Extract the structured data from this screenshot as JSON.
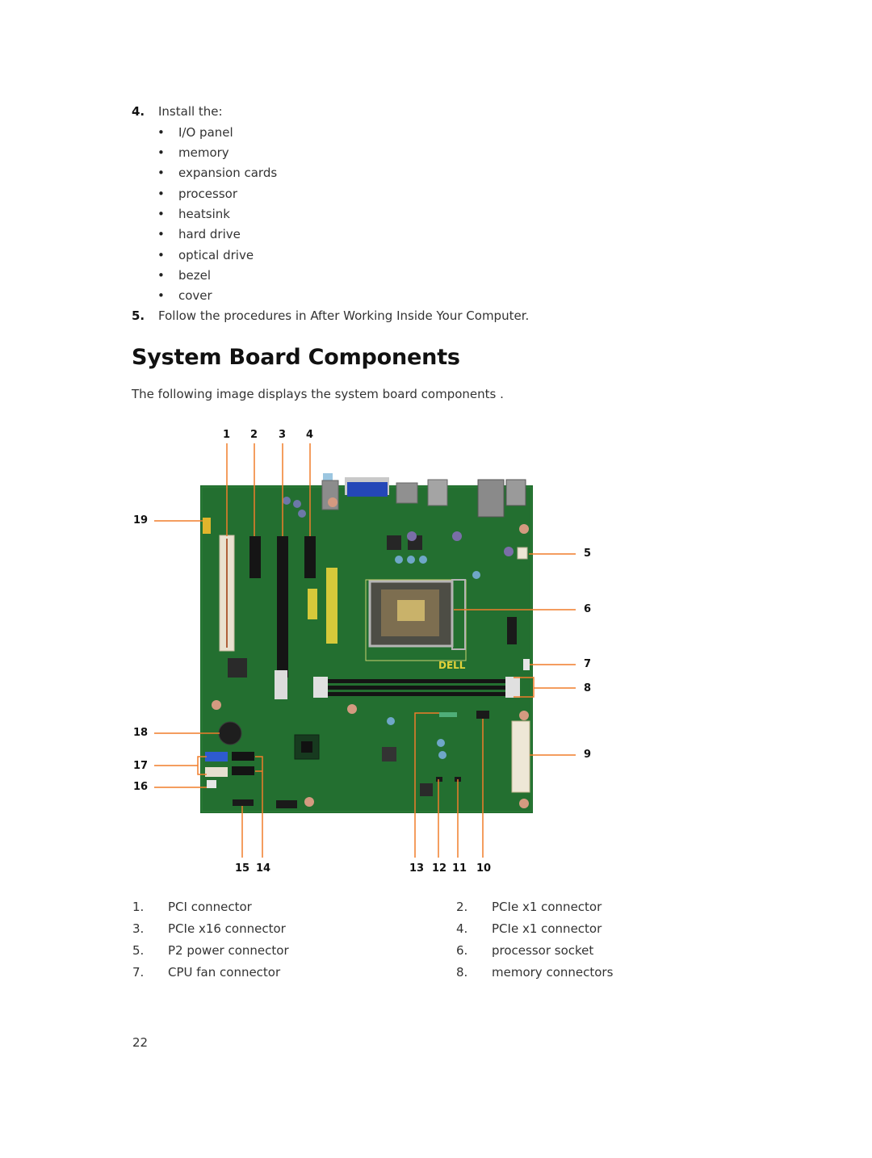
{
  "steps": [
    {
      "number": "4.",
      "text": "Install the:",
      "items": [
        "I/O panel",
        "memory",
        "expansion cards",
        "processor",
        "heatsink",
        "hard drive",
        "optical drive",
        "bezel",
        "cover"
      ]
    },
    {
      "number": "5.",
      "text": "Follow the procedures in After Working Inside Your Computer."
    }
  ],
  "section": {
    "title": "System Board Components",
    "intro": "The following image displays the system board components ."
  },
  "figure": {
    "accent_color": "#f07d2a",
    "board_color": "#1f6b2c",
    "callouts": {
      "c1": "1",
      "c2": "2",
      "c3": "3",
      "c4": "4",
      "c5": "5",
      "c6": "6",
      "c7": "7",
      "c8": "8",
      "c9": "9",
      "c10": "10",
      "c11": "11",
      "c12": "12",
      "c13": "13",
      "c14": "14",
      "c15": "15",
      "c16": "16",
      "c17": "17",
      "c18": "18",
      "c19": "19"
    },
    "logo": "DELL"
  },
  "legend": [
    {
      "num": "1.",
      "label": "PCI connector"
    },
    {
      "num": "2.",
      "label": "PCIe x1 connector"
    },
    {
      "num": "3.",
      "label": "PCIe x16 connector"
    },
    {
      "num": "4.",
      "label": "PCIe x1 connector"
    },
    {
      "num": "5.",
      "label": "P2 power connector"
    },
    {
      "num": "6.",
      "label": "processor socket"
    },
    {
      "num": "7.",
      "label": "CPU fan connector"
    },
    {
      "num": "8.",
      "label": "memory connectors"
    }
  ],
  "page_number": "22"
}
